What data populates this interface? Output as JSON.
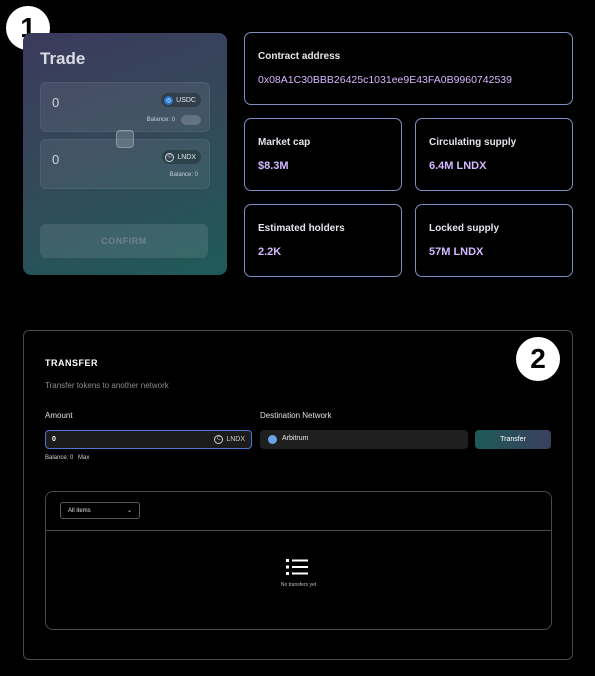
{
  "badges": {
    "one": "1",
    "two": "2"
  },
  "trade": {
    "title": "Trade",
    "from": {
      "value": "0",
      "token": "USDC",
      "balance_label": "Balance: 0"
    },
    "to": {
      "value": "0",
      "token": "LNDX",
      "balance_label": "Balance: 0"
    },
    "confirm_label": "CONFIRM"
  },
  "stats": {
    "contract": {
      "label": "Contract address",
      "value": "0x08A1C30BBB26425c1031ee9E43FA0B9960742539"
    },
    "market_cap": {
      "label": "Market cap",
      "value": "$8.3M"
    },
    "circulating": {
      "label": "Circulating supply",
      "value": "6.4M LNDX"
    },
    "holders": {
      "label": "Estimated holders",
      "value": "2.2K"
    },
    "locked": {
      "label": "Locked supply",
      "value": "57M LNDX"
    }
  },
  "transfer": {
    "title": "TRANSFER",
    "subtitle": "Transfer tokens to another network",
    "amount_label": "Amount",
    "amount_value": "0",
    "amount_unit": "LNDX",
    "destination_label": "Destination Network",
    "destination_value": "Arbitrum",
    "button_label": "Transfer",
    "balance_text": "Balance: 0",
    "max_label": "Max",
    "filter_value": "All items",
    "empty_text": "No transfers yet"
  },
  "colors": {
    "accent_border": "#7c8fc4",
    "value_purple": "#d4b8ff",
    "input_focus": "#4f74d6"
  },
  "icons": [
    "usdc-icon",
    "lndx-icon",
    "swap-icon",
    "arbitrum-icon",
    "chevron-down-icon",
    "list-icon"
  ]
}
